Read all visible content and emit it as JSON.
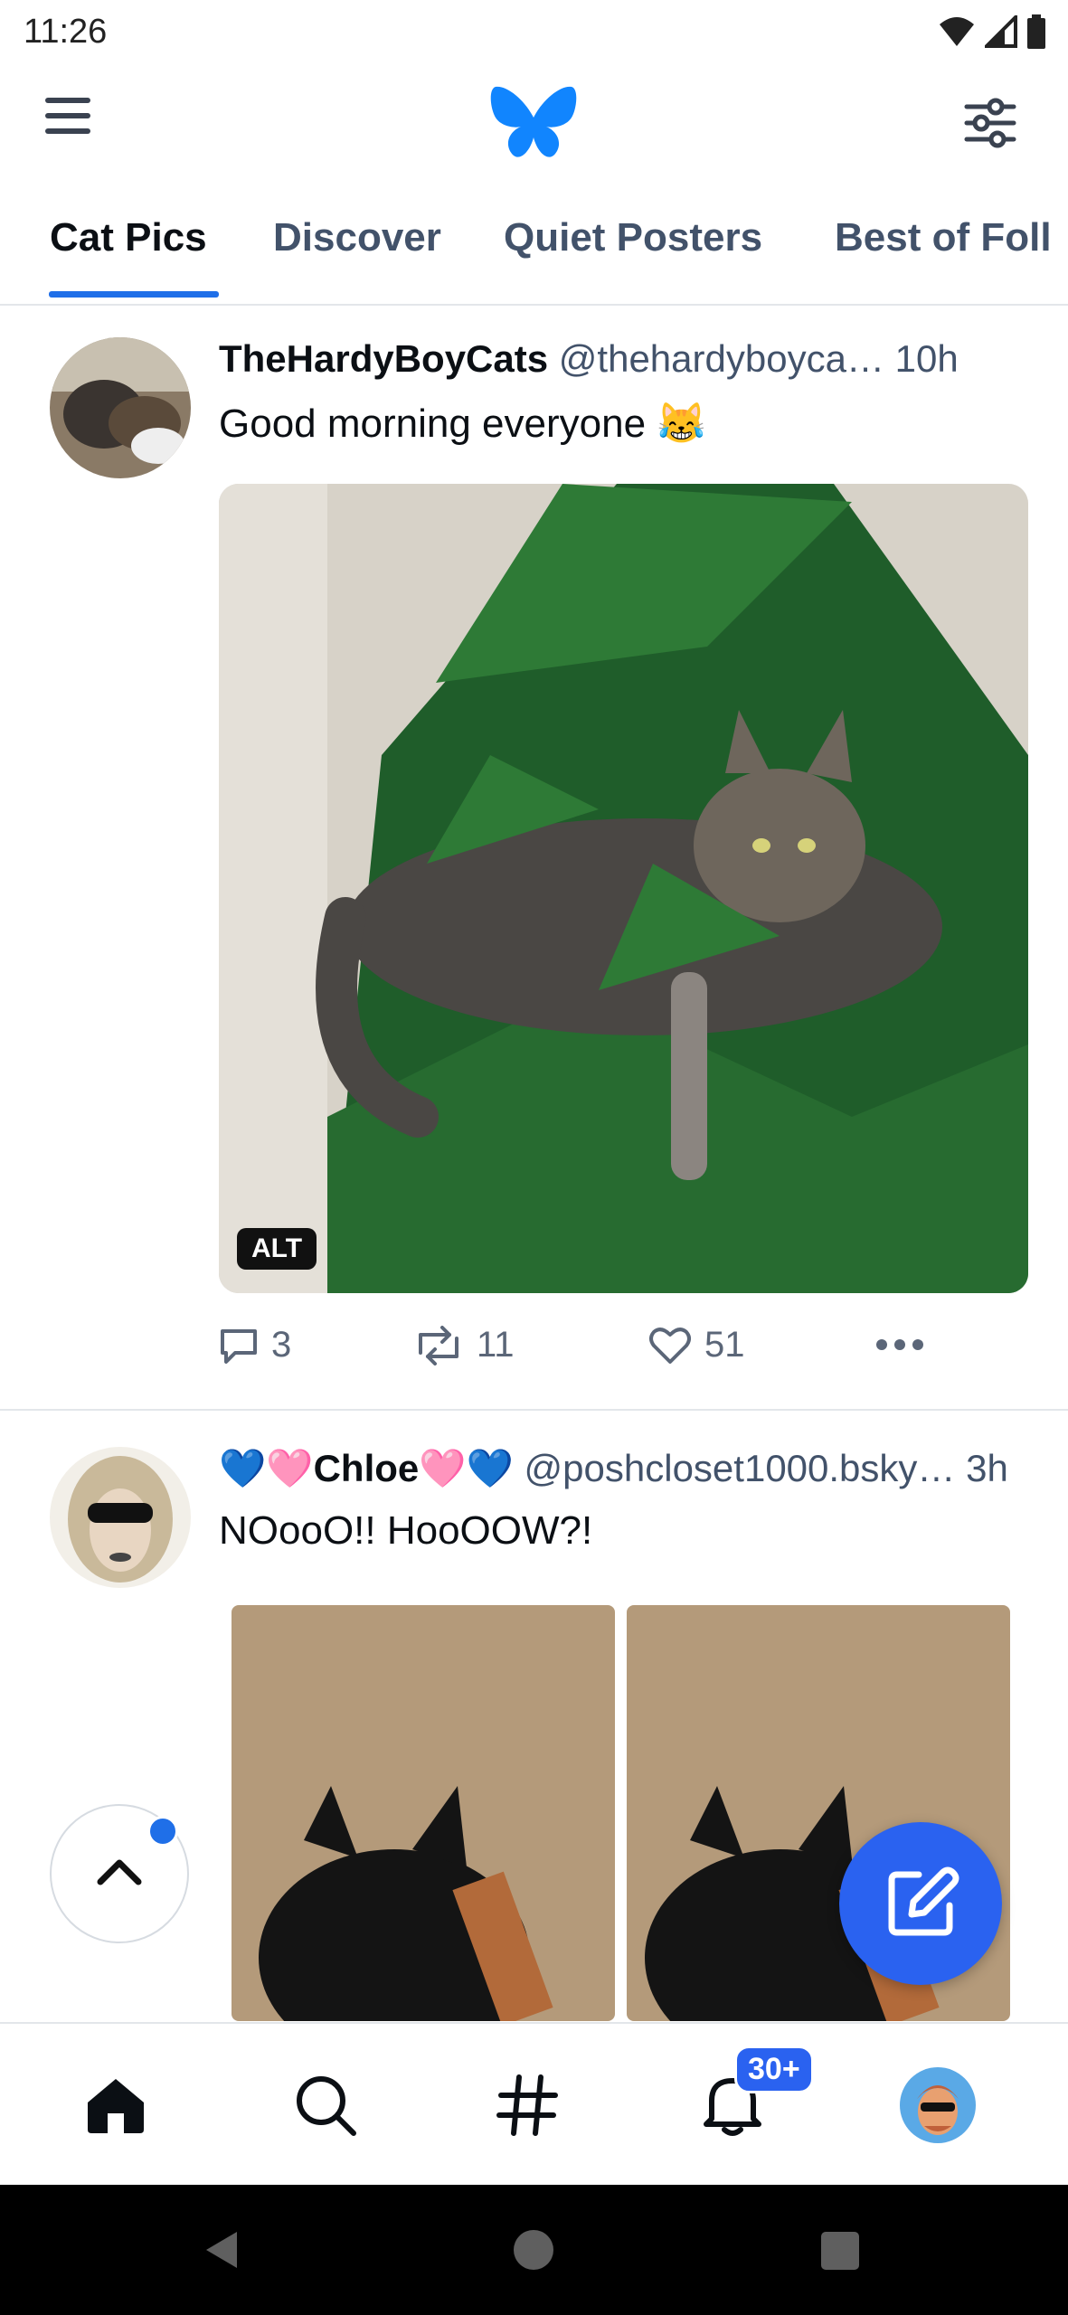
{
  "status_bar": {
    "time": "11:26",
    "icons": [
      "wifi-icon",
      "signal-icon",
      "battery-icon"
    ]
  },
  "header": {
    "menu_icon": "hamburger-icon",
    "logo": "butterfly-logo",
    "filter_icon": "sliders-icon"
  },
  "tabs": [
    {
      "label": "Cat Pics",
      "active": true
    },
    {
      "label": "Discover",
      "active": false
    },
    {
      "label": "Quiet Posters",
      "active": false
    },
    {
      "label": "Best of Foll",
      "active": false
    }
  ],
  "posts": [
    {
      "author": "TheHardyBoyCats",
      "handle": "@thehardyboyca…",
      "time": "10h",
      "text": "Good morning everyone 😹",
      "alt_label": "ALT",
      "replies": "3",
      "reposts": "11",
      "likes": "51"
    },
    {
      "author": "💙🩷Chloe🩷💙",
      "handle": "@poshcloset1000.bsky…",
      "time": "3h",
      "text": "NOooO!! HooOOW?!"
    }
  ],
  "bottom_nav": {
    "items": [
      "home-icon",
      "search-icon",
      "feeds-icon",
      "notifications-icon",
      "profile-avatar"
    ],
    "notifications_badge": "30+"
  },
  "colors": {
    "accent": "#1f6fe8",
    "compose": "#2a62f0",
    "text_secondary": "#42526a"
  }
}
